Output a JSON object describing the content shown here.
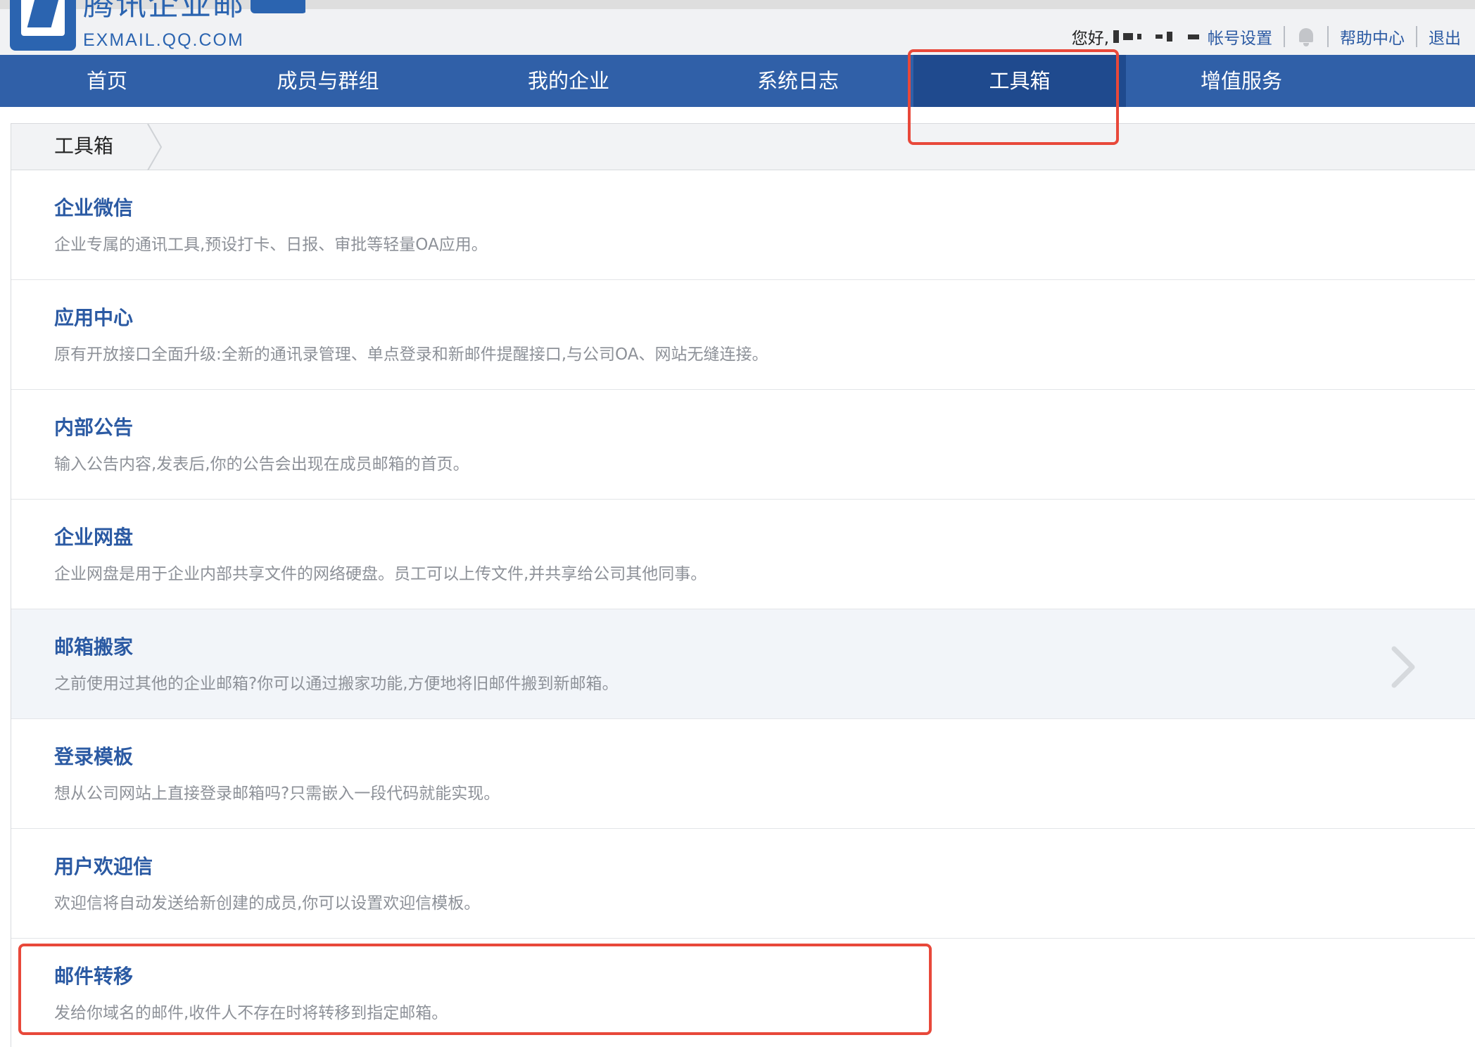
{
  "brand": {
    "name_cn": "腾讯企业邮",
    "domain": "EXMAIL.QQ.COM"
  },
  "user_bar": {
    "greeting": "您好,",
    "account_settings": "帐号设置",
    "help_center": "帮助中心",
    "logout": "退出"
  },
  "nav": {
    "items": [
      {
        "label": "首页"
      },
      {
        "label": "成员与群组"
      },
      {
        "label": "我的企业"
      },
      {
        "label": "系统日志"
      },
      {
        "label": "工具箱",
        "active": true
      },
      {
        "label": "增值服务"
      }
    ]
  },
  "breadcrumb": {
    "current": "工具箱"
  },
  "tools": [
    {
      "title": "企业微信",
      "desc": "企业专属的通讯工具,预设打卡、日报、审批等轻量OA应用。"
    },
    {
      "title": "应用中心",
      "desc": "原有开放接口全面升级:全新的通讯录管理、单点登录和新邮件提醒接口,与公司OA、网站无缝连接。"
    },
    {
      "title": "内部公告",
      "desc": "输入公告内容,发表后,你的公告会出现在成员邮箱的首页。"
    },
    {
      "title": "企业网盘",
      "desc": "企业网盘是用于企业内部共享文件的网络硬盘。员工可以上传文件,并共享给公司其他同事。"
    },
    {
      "title": "邮箱搬家",
      "desc": "之前使用过其他的企业邮箱?你可以通过搬家功能,方便地将旧邮件搬到新邮箱。",
      "hovered": true
    },
    {
      "title": "登录模板",
      "desc": "想从公司网站上直接登录邮箱吗?只需嵌入一段代码就能实现。"
    },
    {
      "title": "用户欢迎信",
      "desc": "欢迎信将自动发送给新创建的成员,你可以设置欢迎信模板。"
    },
    {
      "title": "邮件转移",
      "desc": "发给你域名的邮件,收件人不存在时将转移到指定邮箱。"
    }
  ],
  "colors": {
    "nav_bg": "#3060a8",
    "nav_active": "#1f4a8e",
    "link": "#2b5aa3",
    "annotation": "#e8483a"
  }
}
